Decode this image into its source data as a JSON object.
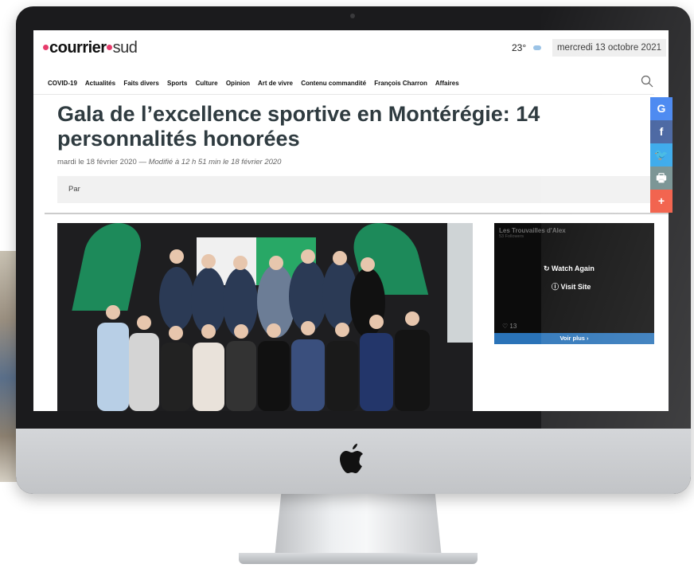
{
  "site": {
    "logo_part1": "courrier",
    "logo_part2": "sud"
  },
  "weather": {
    "temperature": "23°",
    "date": "mercredi 13 octobre 2021"
  },
  "nav": [
    "COVID-19",
    "Actualités",
    "Faits divers",
    "Sports",
    "Culture",
    "Opinion",
    "Art de vivre",
    "Contenu commandité",
    "François Charron",
    "Affaires"
  ],
  "article": {
    "title": "Gala de l’excellence sportive en Montérégie: 14 personnalités honorées",
    "date": "mardi le 18 février 2020",
    "separator": " — ",
    "modified": "Modifié à 12 h 51 min le 18 février 2020",
    "author_label": "Par"
  },
  "video": {
    "channel": "Les Trouvailles d'Alex",
    "followers": "53 Followers",
    "watch_again": "Watch Again",
    "visit_site": "Visit Site",
    "likes": "13",
    "see_more": "Voir plus ›"
  },
  "share": [
    {
      "icon": "google-icon",
      "label": "G",
      "color": "#3c7ff0"
    },
    {
      "icon": "facebook-icon",
      "label": "f",
      "color": "#3b5a9a"
    },
    {
      "icon": "twitter-icon",
      "label": "🐦",
      "color": "#2ba3ea"
    },
    {
      "icon": "print-icon",
      "label": "🖶",
      "color": "#6d8a8a"
    },
    {
      "icon": "plus-icon",
      "label": "+",
      "color": "#f1523a"
    }
  ]
}
